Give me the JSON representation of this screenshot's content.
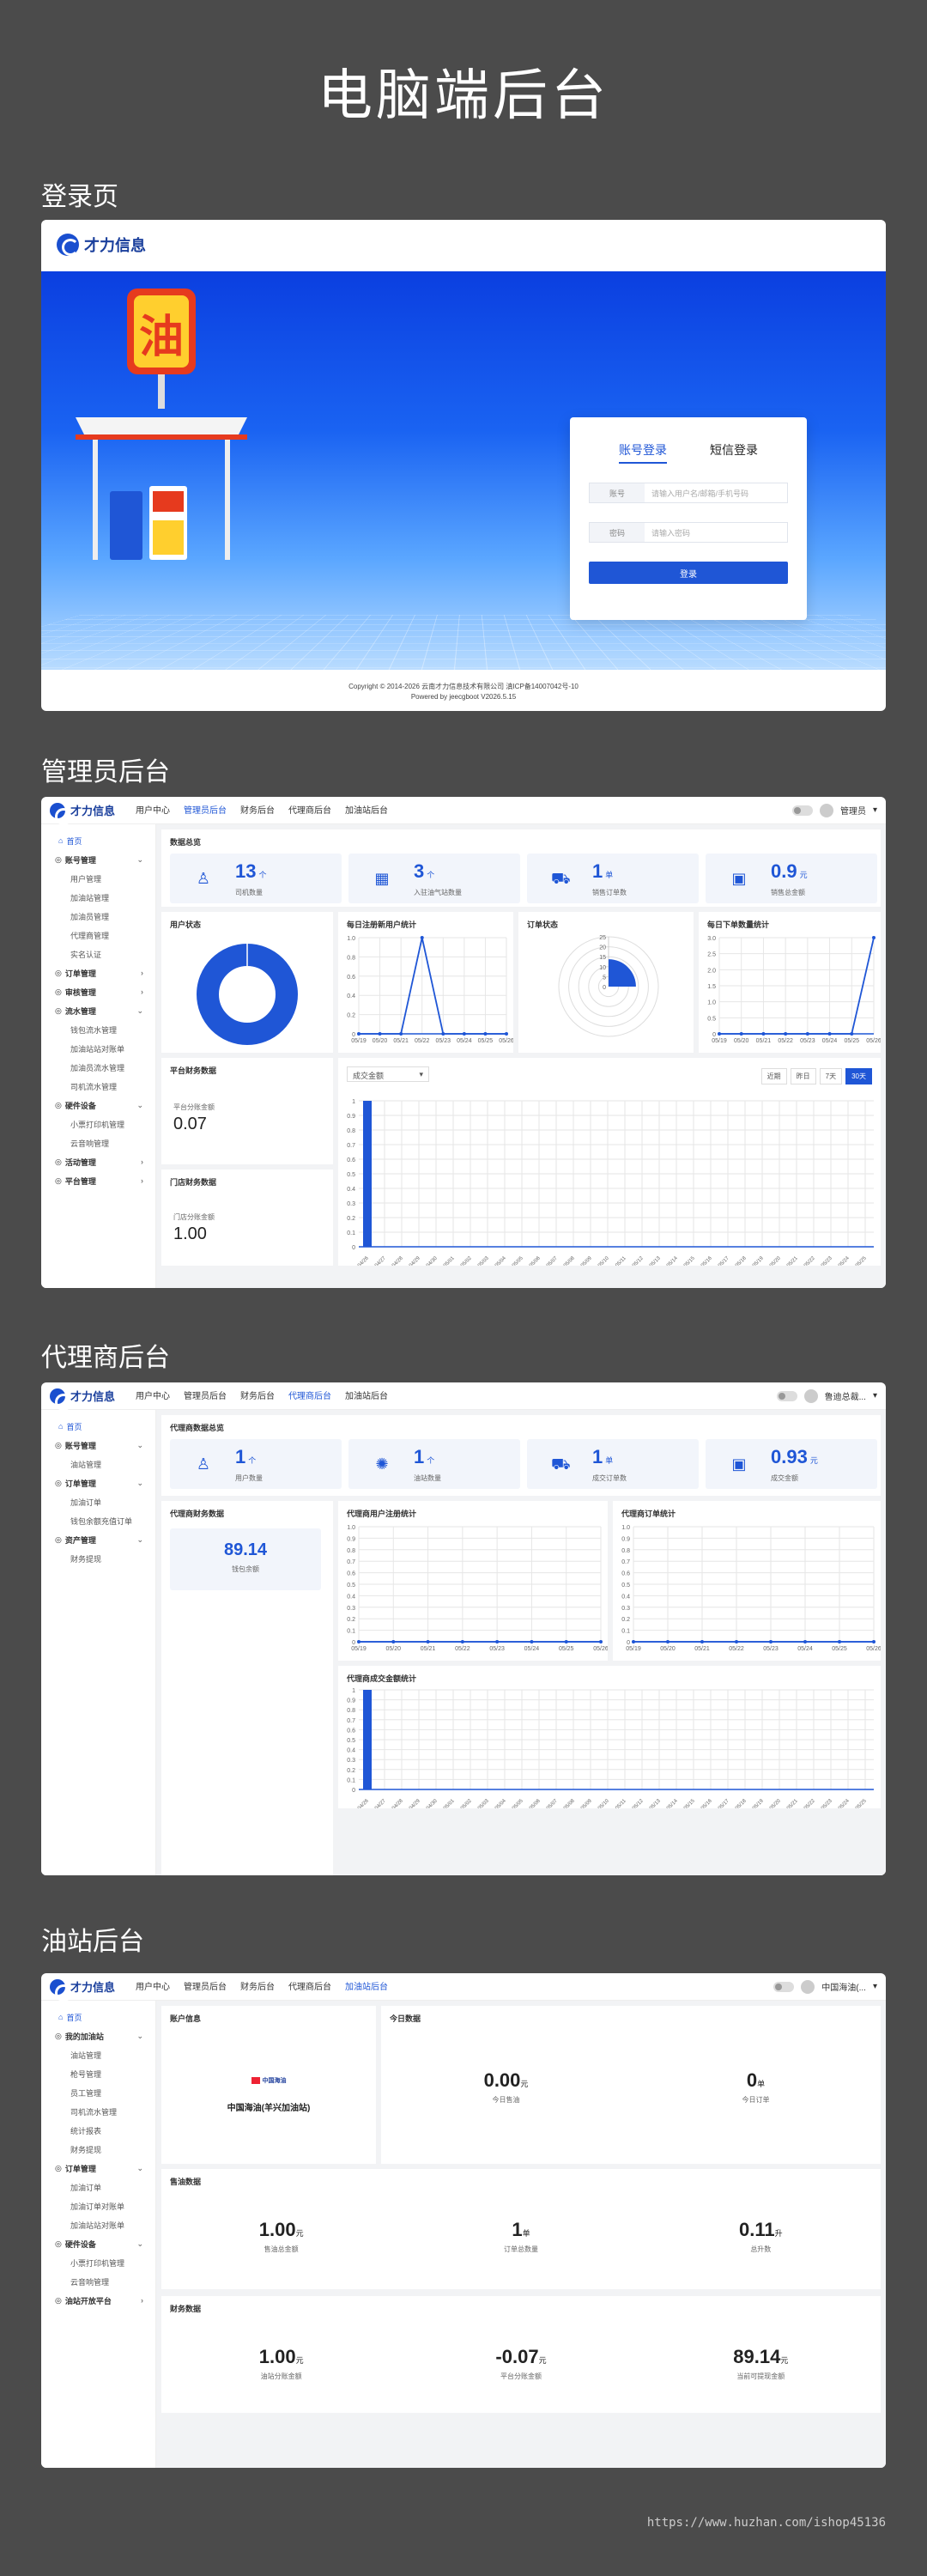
{
  "page_title": "电脑端后台",
  "sections": {
    "login": "登录页",
    "admin": "管理员后台",
    "agent": "代理商后台",
    "station": "油站后台"
  },
  "brand": "才力信息",
  "login": {
    "tab_account": "账号登录",
    "tab_sms": "短信登录",
    "account_label": "账号",
    "account_placeholder": "请输入用户名/邮箱/手机号码",
    "password_label": "密码",
    "password_placeholder": "请输入密码",
    "submit": "登录",
    "footer_line1": "Copyright © 2014-2026 云南才力信息技术有限公司 滇ICP备14007042号-10",
    "footer_line2": "Powered by jeecgboot V2026.5.15",
    "station_sign": "油"
  },
  "topnav": [
    "用户中心",
    "管理员后台",
    "财务后台",
    "代理商后台",
    "加油站后台"
  ],
  "admin": {
    "user": "管理员",
    "sidebar": [
      {
        "label": "首页",
        "type": "home"
      },
      {
        "label": "账号管理",
        "type": "grp",
        "open": true
      },
      {
        "label": "用户管理",
        "type": "sub"
      },
      {
        "label": "加油站管理",
        "type": "sub"
      },
      {
        "label": "加油员管理",
        "type": "sub"
      },
      {
        "label": "代理商管理",
        "type": "sub"
      },
      {
        "label": "实名认证",
        "type": "sub"
      },
      {
        "label": "订单管理",
        "type": "grp"
      },
      {
        "label": "审核管理",
        "type": "grp"
      },
      {
        "label": "流水管理",
        "type": "grp",
        "open": true
      },
      {
        "label": "钱包流水管理",
        "type": "sub"
      },
      {
        "label": "加油站站对账单",
        "type": "sub"
      },
      {
        "label": "加油员流水管理",
        "type": "sub"
      },
      {
        "label": "司机流水管理",
        "type": "sub"
      },
      {
        "label": "硬件设备",
        "type": "grp",
        "open": true
      },
      {
        "label": "小票打印机管理",
        "type": "sub"
      },
      {
        "label": "云音响管理",
        "type": "sub"
      },
      {
        "label": "活动管理",
        "type": "grp"
      },
      {
        "label": "平台管理",
        "type": "grp"
      }
    ],
    "overview_title": "数据总览",
    "stats": [
      {
        "value": "13",
        "unit": "个",
        "label": "司机数量",
        "icon": "user-icon"
      },
      {
        "value": "3",
        "unit": "个",
        "label": "入驻油气站数量",
        "icon": "building-icon"
      },
      {
        "value": "1",
        "unit": "单",
        "label": "销售订单数",
        "icon": "cart-icon"
      },
      {
        "value": "0.9",
        "unit": "元",
        "label": "销售总金额",
        "icon": "register-icon"
      }
    ],
    "user_status_title": "用户状态",
    "daily_reg_title": "每日注册新用户统计",
    "order_status_title": "订单状态",
    "daily_order_title": "每日下单数量统计",
    "platform_finance_title": "平台财务数据",
    "platform_share_label": "平台分账金额",
    "platform_share_value": "0.07",
    "store_finance_title": "门店财务数据",
    "store_share_label": "门店分账金额",
    "store_share_value": "1.00",
    "select_value": "成交金额",
    "range_buttons": [
      "近期",
      "昨日",
      "7天",
      "30天"
    ]
  },
  "agent": {
    "user": "鲁迪总裁...",
    "sidebar": [
      {
        "label": "首页",
        "type": "home"
      },
      {
        "label": "账号管理",
        "type": "grp",
        "open": true
      },
      {
        "label": "油站管理",
        "type": "sub"
      },
      {
        "label": "订单管理",
        "type": "grp",
        "open": true
      },
      {
        "label": "加油订单",
        "type": "sub"
      },
      {
        "label": "钱包余额充值订单",
        "type": "sub"
      },
      {
        "label": "资产管理",
        "type": "grp",
        "open": true
      },
      {
        "label": "财务提现",
        "type": "sub"
      }
    ],
    "overview_title": "代理商数据总览",
    "stats": [
      {
        "value": "1",
        "unit": "个",
        "label": "用户数量",
        "icon": "user-icon"
      },
      {
        "value": "1",
        "unit": "个",
        "label": "油站数量",
        "icon": "gear-icon"
      },
      {
        "value": "1",
        "unit": "单",
        "label": "成交订单数",
        "icon": "cart-icon"
      },
      {
        "value": "0.93",
        "unit": "元",
        "label": "成交金额",
        "icon": "register-icon"
      }
    ],
    "finance_title": "代理商财务数据",
    "wallet_value": "89.14",
    "wallet_label": "钱包余额",
    "user_reg_title": "代理商用户注册统计",
    "order_stat_title": "代理商订单统计",
    "amount_title": "代理商成交金额统计"
  },
  "station": {
    "user": "中国海油(...",
    "sidebar": [
      {
        "label": "首页",
        "type": "home"
      },
      {
        "label": "我的加油站",
        "type": "grp",
        "open": true
      },
      {
        "label": "油站管理",
        "type": "sub"
      },
      {
        "label": "枪号管理",
        "type": "sub"
      },
      {
        "label": "员工管理",
        "type": "sub"
      },
      {
        "label": "司机流水管理",
        "type": "sub"
      },
      {
        "label": "统计报表",
        "type": "sub"
      },
      {
        "label": "财务提现",
        "type": "sub"
      },
      {
        "label": "订单管理",
        "type": "grp",
        "open": true
      },
      {
        "label": "加油订单",
        "type": "sub"
      },
      {
        "label": "加油订单对账单",
        "type": "sub"
      },
      {
        "label": "加油站站对账单",
        "type": "sub"
      },
      {
        "label": "硬件设备",
        "type": "grp",
        "open": true
      },
      {
        "label": "小票打印机管理",
        "type": "sub"
      },
      {
        "label": "云音响管理",
        "type": "sub"
      },
      {
        "label": "油站开放平台",
        "type": "grp"
      }
    ],
    "account_title": "账户信息",
    "company_logo": "中国海油",
    "station_name": "中国海油(羊兴加油站)",
    "today_title": "今日数据",
    "today": [
      {
        "value": "0.00",
        "unit": "元",
        "label": "今日售油"
      },
      {
        "value": "0",
        "unit": "单",
        "label": "今日订单"
      }
    ],
    "sales_title": "售油数据",
    "sales": [
      {
        "value": "1.00",
        "unit": "元",
        "label": "售油总金额"
      },
      {
        "value": "1",
        "unit": "单",
        "label": "订单总数量"
      },
      {
        "value": "0.11",
        "unit": "升",
        "label": "总升数"
      }
    ],
    "finance_title": "财务数据",
    "finance": [
      {
        "value": "1.00",
        "unit": "元",
        "label": "油站分账金额"
      },
      {
        "value": "-0.07",
        "unit": "元",
        "label": "平台分账金额"
      },
      {
        "value": "89.14",
        "unit": "元",
        "label": "当前可提现金额"
      }
    ]
  },
  "watermark": "https://www.huzhan.com/ishop45136",
  "chart_data": [
    {
      "id": "user-status",
      "type": "pie",
      "title": "用户状态",
      "values": [
        1
      ]
    },
    {
      "id": "daily-reg",
      "type": "line",
      "title": "每日注册新用户统计",
      "categories": [
        "05/19",
        "05/20",
        "05/21",
        "05/22",
        "05/23",
        "05/24",
        "05/25",
        "05/26"
      ],
      "values": [
        0,
        0,
        0,
        1,
        0,
        0,
        0,
        0
      ],
      "ylim": [
        0,
        1
      ],
      "yticks": [
        "0",
        "0.2",
        "0.4",
        "0.6",
        "0.8",
        "1.0"
      ]
    },
    {
      "id": "order-status",
      "type": "pie",
      "title": "订单状态",
      "values": [
        1
      ],
      "yticks": [
        "0",
        "5",
        "10",
        "15",
        "20",
        "25"
      ]
    },
    {
      "id": "daily-order",
      "type": "line",
      "title": "每日下单数量统计",
      "categories": [
        "05/19",
        "05/20",
        "05/21",
        "05/22",
        "05/23",
        "05/24",
        "05/25",
        "05/26"
      ],
      "values": [
        0,
        0,
        0,
        0,
        0,
        0,
        0,
        3
      ],
      "ylim": [
        0,
        3
      ],
      "yticks": [
        "0",
        "0.5",
        "1.0",
        "1.5",
        "2.0",
        "2.5",
        "3.0"
      ]
    },
    {
      "id": "admin-amount",
      "type": "bar",
      "title": "",
      "categories": [
        "04/26",
        "04/27",
        "04/28",
        "04/29",
        "04/30",
        "05/01",
        "05/02",
        "05/03",
        "05/04",
        "05/05",
        "05/06",
        "05/07",
        "05/08",
        "05/09",
        "05/10",
        "05/11",
        "05/12",
        "05/13",
        "05/14",
        "05/15",
        "05/16",
        "05/17",
        "05/18",
        "05/19",
        "05/20",
        "05/21",
        "05/22",
        "05/23",
        "05/24",
        "05/25"
      ],
      "values": [
        1,
        0,
        0,
        0,
        0,
        0,
        0,
        0,
        0,
        0,
        0,
        0,
        0,
        0,
        0,
        0,
        0,
        0,
        0,
        0,
        0,
        0,
        0,
        0,
        0,
        0,
        0,
        0,
        0,
        0
      ],
      "ylim": [
        0,
        1
      ],
      "yticks": [
        "0",
        "0.1",
        "0.2",
        "0.3",
        "0.4",
        "0.5",
        "0.6",
        "0.7",
        "0.8",
        "0.9",
        "1"
      ]
    },
    {
      "id": "agent-reg",
      "type": "line",
      "title": "代理商用户注册统计",
      "categories": [
        "05/19",
        "05/20",
        "05/21",
        "05/22",
        "05/23",
        "05/24",
        "05/25",
        "05/26"
      ],
      "values": [
        0,
        0,
        0,
        0,
        0,
        0,
        0,
        0
      ],
      "ylim": [
        0,
        1
      ],
      "yticks": [
        "0",
        "0.1",
        "0.2",
        "0.3",
        "0.4",
        "0.5",
        "0.6",
        "0.7",
        "0.8",
        "0.9",
        "1.0"
      ]
    },
    {
      "id": "agent-order",
      "type": "line",
      "title": "代理商订单统计",
      "categories": [
        "05/19",
        "05/20",
        "05/21",
        "05/22",
        "05/23",
        "05/24",
        "05/25",
        "05/26"
      ],
      "values": [
        0,
        0,
        0,
        0,
        0,
        0,
        0,
        0
      ],
      "ylim": [
        0,
        1
      ],
      "yticks": [
        "0",
        "0.1",
        "0.2",
        "0.3",
        "0.4",
        "0.5",
        "0.6",
        "0.7",
        "0.8",
        "0.9",
        "1.0"
      ]
    },
    {
      "id": "agent-amount",
      "type": "bar",
      "title": "代理商成交金额统计",
      "categories": [
        "04/26",
        "04/27",
        "04/28",
        "04/29",
        "04/30",
        "05/01",
        "05/02",
        "05/03",
        "05/04",
        "05/05",
        "05/06",
        "05/07",
        "05/08",
        "05/09",
        "05/10",
        "05/11",
        "05/12",
        "05/13",
        "05/14",
        "05/15",
        "05/16",
        "05/17",
        "05/18",
        "05/19",
        "05/20",
        "05/21",
        "05/22",
        "05/23",
        "05/24",
        "05/25"
      ],
      "values": [
        1,
        0,
        0,
        0,
        0,
        0,
        0,
        0,
        0,
        0,
        0,
        0,
        0,
        0,
        0,
        0,
        0,
        0,
        0,
        0,
        0,
        0,
        0,
        0,
        0,
        0,
        0,
        0,
        0,
        0
      ],
      "ylim": [
        0,
        1
      ],
      "yticks": [
        "0",
        "0.1",
        "0.2",
        "0.3",
        "0.4",
        "0.5",
        "0.6",
        "0.7",
        "0.8",
        "0.9",
        "1"
      ]
    }
  ],
  "colors": {
    "accent": "#1f56d6",
    "bg": "#4b4b4b"
  }
}
